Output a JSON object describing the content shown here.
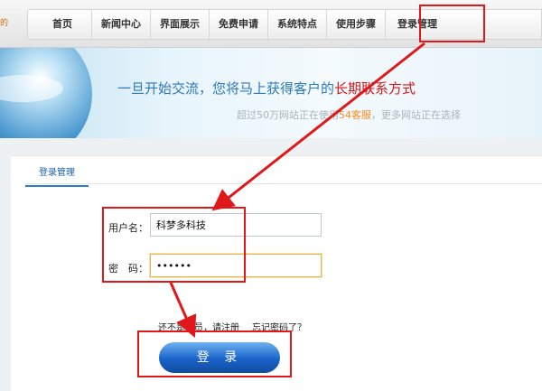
{
  "header": {
    "logo_fragment": "的"
  },
  "nav": {
    "items": [
      "首页",
      "新闻中心",
      "界面展示",
      "免费申请",
      "系统特点",
      "使用步骤",
      "登录管理"
    ]
  },
  "banner": {
    "slogan_prefix": "一旦开始交流，您将马上获得客户的",
    "slogan_highlight": "长期联系方式",
    "sub_prefix": "超过50万网站正在使用",
    "sub_highlight": "54客服",
    "sub_suffix": "，更多网站正在选择"
  },
  "panel": {
    "tab_label": "登录管理",
    "username_label": "用户名：",
    "username_value": "科梦多科技",
    "password_label": "密　码：",
    "password_value": "••••••",
    "register_link": "还不是会员，请注册",
    "forgot_link": "忘记密码了？",
    "login_button": "登 录"
  },
  "annotations": {
    "highlight_color": "#e0181a"
  }
}
